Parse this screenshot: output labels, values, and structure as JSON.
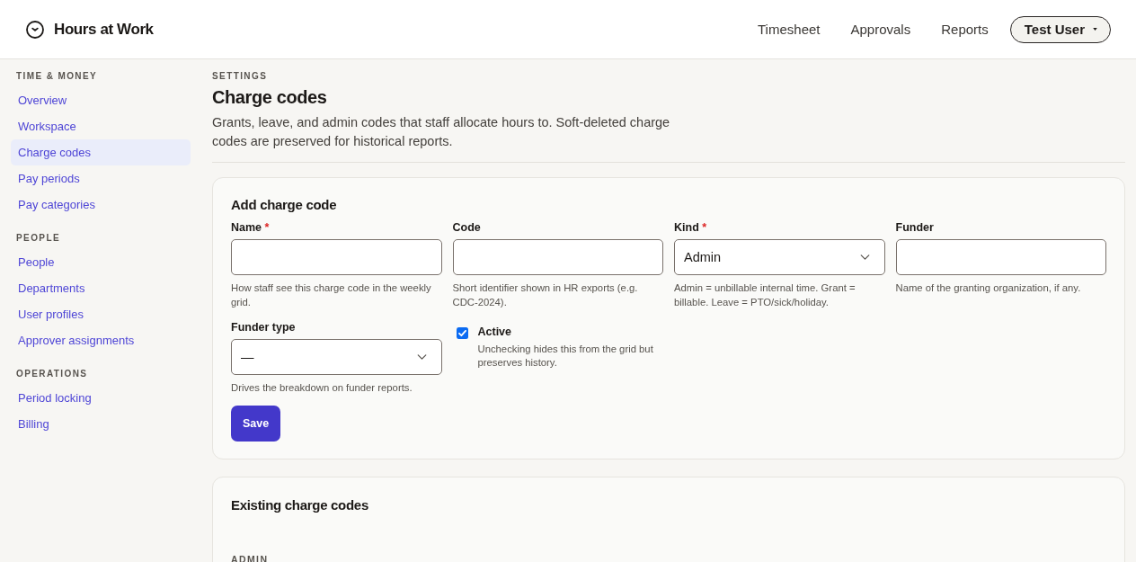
{
  "header": {
    "app_name": "Hours at Work",
    "nav": [
      {
        "label": "Timesheet"
      },
      {
        "label": "Approvals"
      },
      {
        "label": "Reports"
      }
    ],
    "user_menu": {
      "label": "Test User"
    }
  },
  "sidebar": {
    "sections": [
      {
        "heading": "TIME & MONEY",
        "items": [
          {
            "label": "Overview",
            "selected": false
          },
          {
            "label": "Workspace",
            "selected": false
          },
          {
            "label": "Charge codes",
            "selected": true
          },
          {
            "label": "Pay periods",
            "selected": false
          },
          {
            "label": "Pay categories",
            "selected": false
          }
        ]
      },
      {
        "heading": "PEOPLE",
        "items": [
          {
            "label": "People",
            "selected": false
          },
          {
            "label": "Departments",
            "selected": false
          },
          {
            "label": "User profiles",
            "selected": false
          },
          {
            "label": "Approver assignments",
            "selected": false
          }
        ]
      },
      {
        "heading": "OPERATIONS",
        "items": [
          {
            "label": "Period locking",
            "selected": false
          },
          {
            "label": "Billing",
            "selected": false
          }
        ]
      }
    ]
  },
  "page": {
    "eyebrow": "SETTINGS",
    "title": "Charge codes",
    "description": "Grants, leave, and admin codes that staff allocate hours to. Soft-deleted charge codes are preserved for historical reports."
  },
  "add_form": {
    "title": "Add charge code",
    "fields": [
      {
        "kind": "text",
        "label": "Name",
        "required_mark": "*",
        "hint": "How staff see this charge code in the weekly grid."
      },
      {
        "kind": "text",
        "label": "Code",
        "hint": "Short identifier shown in HR exports (e.g. CDC-2024)."
      },
      {
        "kind": "select",
        "label": "Kind",
        "required_mark": "*",
        "value": "Admin",
        "hint": "Admin = unbillable internal time. Grant = billable. Leave = PTO/sick/holiday."
      },
      {
        "kind": "text",
        "label": "Funder",
        "hint": "Name of the granting organization, if any."
      },
      {
        "kind": "select",
        "label": "Funder type",
        "value": "—",
        "hint": "Drives the breakdown on funder reports."
      },
      {
        "kind": "checkbox",
        "label": "Active",
        "checked": true,
        "hint": "Unchecking hides this from the grid but preserves history."
      }
    ],
    "submit": "Save"
  },
  "existing": {
    "title": "Existing charge codes",
    "groups": [
      {
        "heading": "ADMIN"
      }
    ]
  }
}
